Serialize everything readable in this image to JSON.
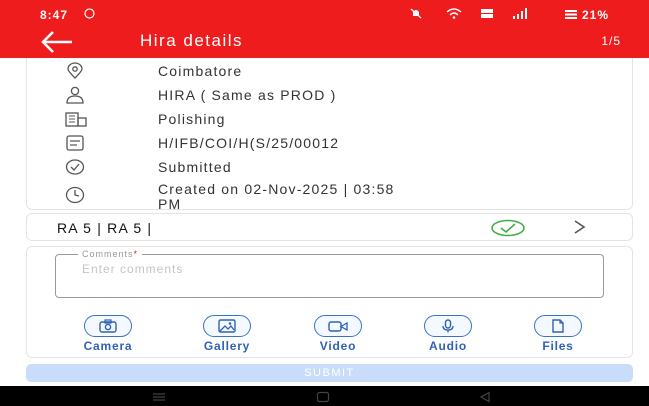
{
  "status_bar": {
    "time": "8:47",
    "battery": "21%"
  },
  "header": {
    "title": "Hira details",
    "pager": "1/5"
  },
  "details": {
    "location": "Coimbatore",
    "owner": "HIRA ( Same as PROD )",
    "department": "Polishing",
    "reference": "H/IFB/COI/H(S/25/00012",
    "status": "Submitted",
    "created_line1": "Created on 02-Nov-2025 | 03:58",
    "created_line2": "PM"
  },
  "ra_row": {
    "label": "RA 5 | RA 5 |",
    "check_icon": "check-circle-icon",
    "arrow_icon": "chevron-right-icon",
    "check_color": "#3cb043"
  },
  "comments": {
    "label": "Comments",
    "required_mark": "*",
    "placeholder": "Enter comments"
  },
  "media_buttons": [
    {
      "label": "Camera",
      "icon": "camera-icon"
    },
    {
      "label": "Gallery",
      "icon": "gallery-icon"
    },
    {
      "label": "Video",
      "icon": "video-icon"
    },
    {
      "label": "Audio",
      "icon": "microphone-icon"
    },
    {
      "label": "Files",
      "icon": "file-icon"
    }
  ],
  "submit": {
    "label": "SUBMIT"
  },
  "colors": {
    "brand_red": "#ee1c1c",
    "accent_blue": "#2f62b3",
    "submit_disabled": "#c9ddfa"
  }
}
